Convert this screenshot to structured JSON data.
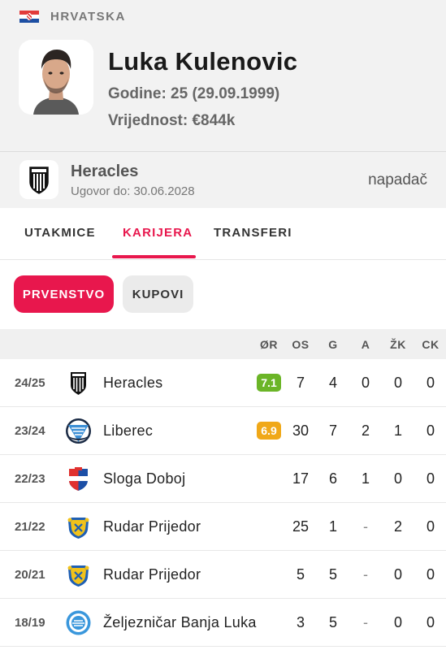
{
  "country": {
    "name": "HRVATSKA",
    "flag_icon": "croatia-flag-icon"
  },
  "player": {
    "name": "Luka Kulenovic",
    "age_line": "Godine: 25 (29.09.1999)",
    "value_line": "Vrijednost: €844k"
  },
  "club": {
    "name": "Heracles",
    "contract": "Ugovor do: 30.06.2028",
    "position": "napadač"
  },
  "tabs": [
    {
      "label": "UTAKMICE",
      "active": false
    },
    {
      "label": "KARIJERA",
      "active": true
    },
    {
      "label": "TRANSFERI",
      "active": false
    }
  ],
  "filters": [
    {
      "label": "PRVENSTVO",
      "active": true
    },
    {
      "label": "KUPOVI",
      "active": false
    }
  ],
  "columns": [
    "ØR",
    "OS",
    "G",
    "A",
    "ŽK",
    "CK"
  ],
  "rows": [
    {
      "season": "24/25",
      "club": "Heracles",
      "logo": "heracles-logo",
      "rating": "7.1",
      "rating_color": "#6bb527",
      "os": "7",
      "g": "4",
      "a": "0",
      "zk": "0",
      "ck": "0"
    },
    {
      "season": "23/24",
      "club": "Liberec",
      "logo": "liberec-logo",
      "rating": "6.9",
      "rating_color": "#f0a818",
      "os": "30",
      "g": "7",
      "a": "2",
      "zk": "1",
      "ck": "0"
    },
    {
      "season": "22/23",
      "club": "Sloga Doboj",
      "logo": "sloga-doboj-logo",
      "rating": "",
      "os": "17",
      "g": "6",
      "a": "1",
      "zk": "0",
      "ck": "0"
    },
    {
      "season": "21/22",
      "club": "Rudar Prijedor",
      "logo": "rudar-prijedor-logo",
      "rating": "",
      "os": "25",
      "g": "1",
      "a": "-",
      "zk": "2",
      "ck": "0"
    },
    {
      "season": "20/21",
      "club": "Rudar Prijedor",
      "logo": "rudar-prijedor-logo",
      "rating": "",
      "os": "5",
      "g": "5",
      "a": "-",
      "zk": "0",
      "ck": "0"
    },
    {
      "season": "18/19",
      "club": "Željezničar Banja Luka",
      "logo": "zeljeznicar-banja-luka-logo",
      "rating": "",
      "os": "3",
      "g": "5",
      "a": "-",
      "zk": "0",
      "ck": "0"
    }
  ]
}
